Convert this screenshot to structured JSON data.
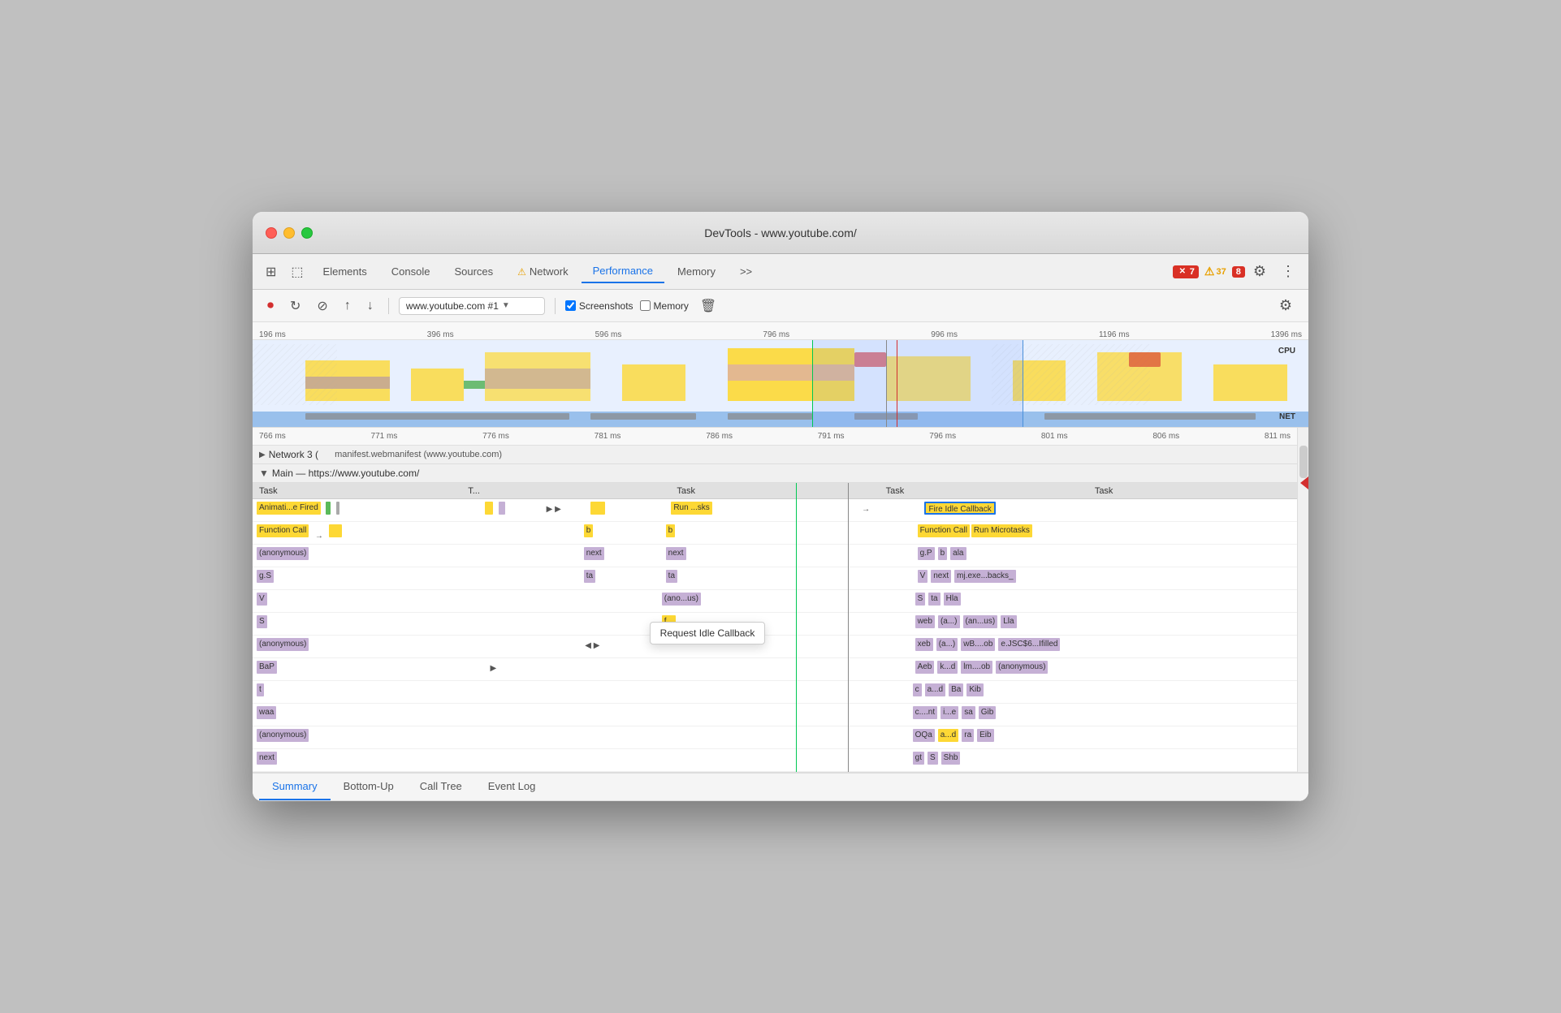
{
  "window": {
    "title": "DevTools - www.youtube.com/"
  },
  "tabs": {
    "items": [
      {
        "label": "Elements",
        "active": false,
        "warn": false
      },
      {
        "label": "Console",
        "active": false,
        "warn": false
      },
      {
        "label": "Sources",
        "active": false,
        "warn": false
      },
      {
        "label": "Network",
        "active": false,
        "warn": true
      },
      {
        "label": "Performance",
        "active": true,
        "warn": false
      },
      {
        "label": "Memory",
        "active": false,
        "warn": false
      }
    ],
    "more_label": ">>",
    "errors": "7",
    "warnings": "37",
    "info": "8"
  },
  "toolbar": {
    "url": "www.youtube.com #1",
    "screenshots_label": "Screenshots",
    "memory_label": "Memory"
  },
  "ruler": {
    "marks": [
      "196 ms",
      "396 ms",
      "596 ms",
      "796 ms",
      "996 ms",
      "1196 ms",
      "1396 ms"
    ]
  },
  "flame_ruler": {
    "marks": [
      "766 ms",
      "771 ms",
      "776 ms",
      "781 ms",
      "786 ms",
      "791 ms",
      "796 ms",
      "801 ms",
      "806 ms",
      "811 ms"
    ]
  },
  "network_track": {
    "label": "Network 3 (",
    "request": "manifest.webmanifest (www.youtube.com)"
  },
  "main_track": {
    "label": "Main — https://www.youtube.com/"
  },
  "flame_columns": [
    "Task",
    "T...",
    "Task",
    "Task",
    "Task"
  ],
  "flame_rows": [
    {
      "label": "Animati...e Fired",
      "cols": [
        "Run ...sks",
        "Fire Idle Callback"
      ],
      "color": "yellow"
    },
    {
      "label": "Function Call",
      "cols": [
        "b",
        "b",
        "Function Call",
        "Run Microtasks"
      ],
      "color": "yellow"
    },
    {
      "label": "(anonymous)",
      "cols": [
        "next",
        "next",
        "g.P",
        "b",
        "ala"
      ],
      "color": "purple"
    },
    {
      "label": "g.S",
      "cols": [
        "ta",
        "ta",
        "V",
        "next",
        "mj.exe...backs_"
      ],
      "color": "purple"
    },
    {
      "label": "V",
      "cols": [
        "(ano...us)",
        "S",
        "ta",
        "Hla"
      ],
      "color": "purple"
    },
    {
      "label": "S",
      "cols": [
        "f...",
        "web",
        "(a...)",
        "(an...us)",
        "Lla"
      ],
      "color": "purple"
    },
    {
      "label": "(anonymous)",
      "cols": [
        "xeb",
        "(a...)",
        "wB....ob",
        "e.JSC$6...Ifilled"
      ],
      "color": "purple"
    },
    {
      "label": "BaP",
      "cols": [
        "Aeb",
        "k...d",
        "lm....ob",
        "(anonymous)"
      ],
      "color": "purple"
    },
    {
      "label": "t",
      "cols": [
        "c",
        "a...d",
        "Ba",
        "Kib"
      ],
      "color": "purple"
    },
    {
      "label": "waa",
      "cols": [
        "c....nt",
        "i...e",
        "sa",
        "Gib"
      ],
      "color": "purple"
    },
    {
      "label": "(anonymous)",
      "cols": [
        "OQa",
        "a...d",
        "ra",
        "Eib"
      ],
      "color": "purple"
    },
    {
      "label": "next",
      "cols": [
        "gt",
        "S",
        "Shb"
      ],
      "color": "purple"
    }
  ],
  "tooltip": {
    "text": "Request Idle Callback"
  },
  "bottom_tabs": [
    {
      "label": "Summary",
      "active": true
    },
    {
      "label": "Bottom-Up",
      "active": false
    },
    {
      "label": "Call Tree",
      "active": false
    },
    {
      "label": "Event Log",
      "active": false
    }
  ]
}
